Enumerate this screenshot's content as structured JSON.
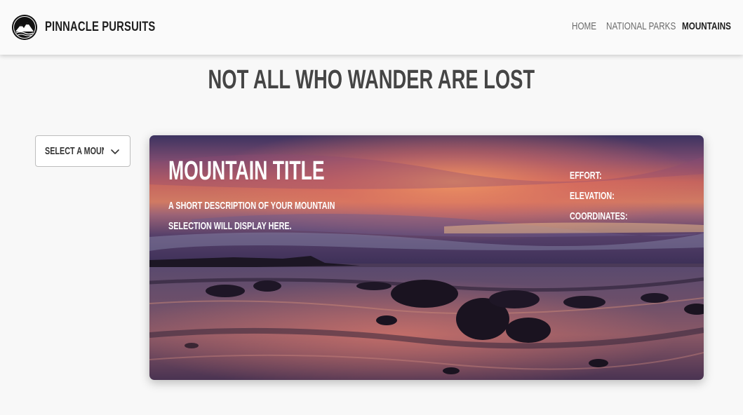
{
  "brand": {
    "name": "PINNACLE PURSUITS",
    "logo_icon": "mountain-logo-icon"
  },
  "nav": {
    "items": [
      {
        "label": "HOME",
        "active": false
      },
      {
        "label": "NATIONAL PARKS",
        "active": false
      },
      {
        "label": "MOUNTAINS",
        "active": true
      }
    ]
  },
  "headline": "NOT ALL WHO WANDER ARE LOST",
  "selector": {
    "value": "SELECT A MOUN",
    "icon": "chevron-down-icon"
  },
  "card": {
    "title": "MOUNTAIN TITLE",
    "description_line1": "A SHORT DESCRIPTION OF YOUR MOUNTAIN",
    "description_line2": "SELECTION WILL DISPLAY HERE.",
    "effort_label": "EFFORT:",
    "elevation_label": "ELEVATION:",
    "coordinates_label": "COORDINATES:"
  },
  "colors": {
    "page_bg": "#f8f8f8",
    "nav_bg": "#fafafa",
    "headline": "#454545",
    "active_nav": "#1e1e1e",
    "inactive_nav": "#6b6b6b"
  }
}
